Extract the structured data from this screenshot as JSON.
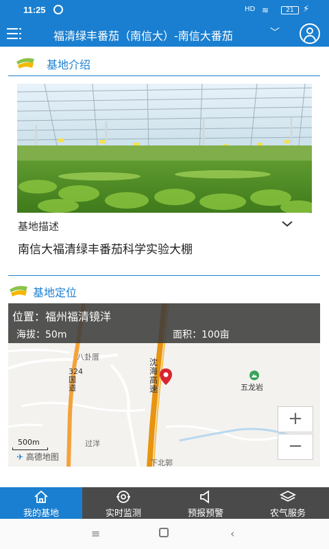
{
  "status_bar": {
    "time": "11:25",
    "signal": "HD",
    "battery": "21"
  },
  "app_bar": {
    "title": "福清绿丰番茄（南信大）-南信大番茄"
  },
  "intro_section": {
    "heading": "基地介绍",
    "description_label": "基地描述",
    "description_text": "南信大福清绿丰番茄科学实验大棚"
  },
  "location_section": {
    "heading": "基地定位",
    "location_line": "位置：福州福清镜洋",
    "altitude": "海拔：50m",
    "area": "面积：100亩",
    "scale_label": "500m",
    "map_provider": "高德地图",
    "map_labels": [
      "八卦厝",
      "沈海高速",
      "五龙岩",
      "过洋",
      "下北郭",
      "324国道"
    ]
  },
  "tabs": [
    {
      "label": "我的基地",
      "icon": "home-icon",
      "active": true
    },
    {
      "label": "实时监测",
      "icon": "monitor-icon",
      "active": false
    },
    {
      "label": "预报预警",
      "icon": "speaker-icon",
      "active": false
    },
    {
      "label": "农气服务",
      "icon": "layers-icon",
      "active": false
    }
  ],
  "colors": {
    "primary": "#1a7fd0",
    "tabbar": "#4a4a4a",
    "road": "#f3a23a",
    "highway": "#f0a020",
    "pin": "#d9252f"
  }
}
